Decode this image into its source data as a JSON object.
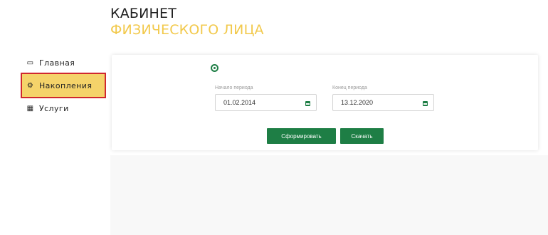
{
  "header": {
    "title_line1": "КАБИНЕТ",
    "title_line2": "ФИЗИЧЕСКОГО ЛИЦА"
  },
  "sidebar": {
    "items": [
      {
        "label": "Главная",
        "icon": "monitor-icon",
        "glyph": "▭"
      },
      {
        "label": "Накопления",
        "icon": "settings-icon",
        "glyph": "⚙"
      },
      {
        "label": "Услуги",
        "icon": "grid-icon",
        "glyph": "▦"
      }
    ],
    "active_index": 1
  },
  "form": {
    "radio_label": "",
    "start": {
      "label": "Начало периода",
      "value": "01.02.2014"
    },
    "end": {
      "label": "Конец периода",
      "value": "13.12.2020"
    },
    "generate_label": "Сформировать",
    "download_label": "Скачать"
  },
  "colors": {
    "accent_green": "#1e7e45",
    "brand_yellow": "#f2c94c",
    "highlight_red": "#d0282e"
  }
}
